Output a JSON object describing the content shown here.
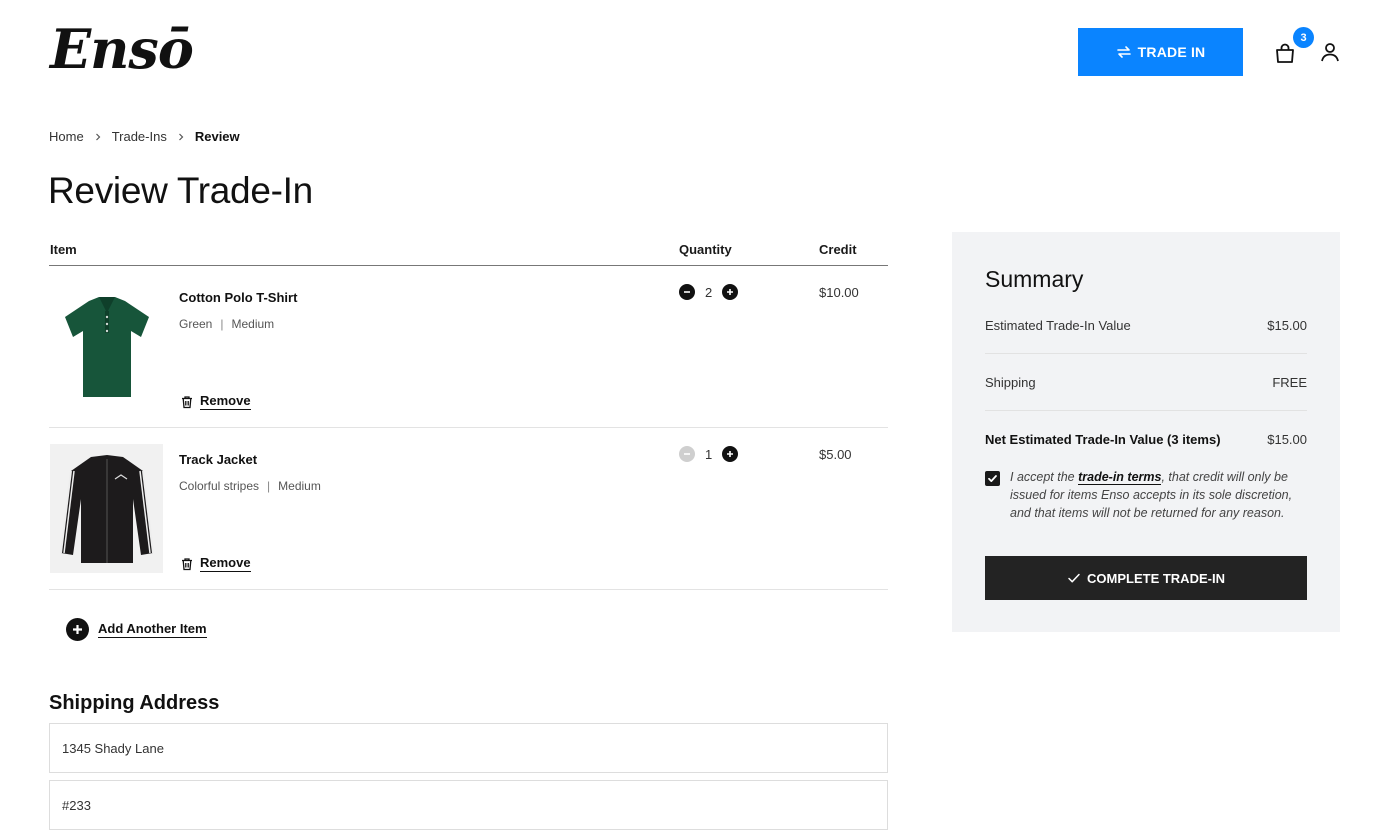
{
  "brand": {
    "logo_text": "Ensō",
    "accent": "#0a84ff"
  },
  "header": {
    "trade_in_label": "TRADE IN",
    "cart_count": "3"
  },
  "breadcrumb": {
    "items": [
      "Home",
      "Trade-Ins",
      "Review"
    ]
  },
  "page": {
    "title": "Review Trade-In"
  },
  "table": {
    "headers": {
      "item": "Item",
      "quantity": "Quantity",
      "credit": "Credit"
    },
    "rows": [
      {
        "name": "Cotton Polo T-Shirt",
        "color": "Green",
        "size": "Medium",
        "quantity": "2",
        "credit": "$10.00",
        "remove_label": "Remove"
      },
      {
        "name": "Track Jacket",
        "color": "Colorful stripes",
        "size": "Medium",
        "quantity": "1",
        "credit": "$5.00",
        "remove_label": "Remove"
      }
    ],
    "add_item_label": "Add Another Item"
  },
  "shipping": {
    "title": "Shipping Address",
    "line1": "1345 Shady Lane",
    "line2": "#233"
  },
  "summary": {
    "title": "Summary",
    "estimated_label": "Estimated Trade-In Value",
    "estimated_value": "$15.00",
    "shipping_label": "Shipping",
    "shipping_value": "FREE",
    "net_label": "Net Estimated Trade-In Value (3 items)",
    "net_value": "$15.00",
    "accept_prefix": "I accept the ",
    "accept_link": "trade-in terms",
    "accept_suffix": ", that credit will only be issued for items Enso accepts in its sole discretion, and that items will not be returned for any reason.",
    "accept_checked": true,
    "complete_label": "COMPLETE TRADE-IN"
  }
}
